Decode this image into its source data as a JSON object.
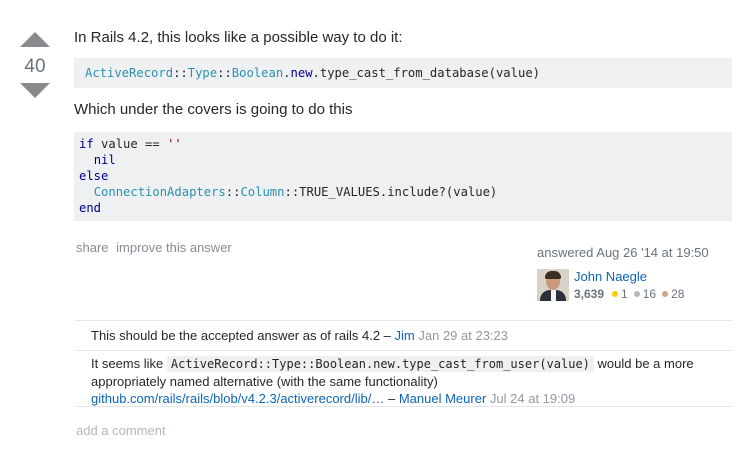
{
  "vote": {
    "score": "40"
  },
  "answer": {
    "intro": "In Rails 4.2, this looks like a possible way to do it:",
    "inline_code": {
      "t1": "ActiveRecord",
      "s1": "::",
      "t2": "Type",
      "s2": "::",
      "t3": "Boolean",
      "s3": ".",
      "k1": "new",
      "rest": ".type_cast_from_database(value)"
    },
    "middle": "Which under the covers is going to do this",
    "block": {
      "l1_kw": "if",
      "l1_mid": " value == ",
      "l1_str": "''",
      "l2_kw": "nil",
      "l3_kw": "else",
      "l4_t1": "ConnectionAdapters",
      "l4_s1": "::",
      "l4_t2": "Column",
      "l4_rest": "::TRUE_VALUES.include?(value)",
      "l5_kw": "end"
    }
  },
  "menu": {
    "share": "share",
    "improve": "improve this answer"
  },
  "signature": {
    "action": "answered",
    "time": "Aug 26 '14 at 19:50",
    "user_name": "John Naegle",
    "reputation": "3,639",
    "gold": "1",
    "silver": "16",
    "bronze": "28",
    "colors": {
      "gold": "#ffcc01",
      "silver": "#b4b8bc",
      "bronze": "#d1a684"
    }
  },
  "comments": [
    {
      "text": "This should be the accepted answer as of rails 4.2 –",
      "user": "Jim",
      "date": "Jan 29 at 23:23"
    },
    {
      "text_before": "It seems like",
      "code": "ActiveRecord::Type::Boolean.new.type_cast_from_user(value)",
      "text_after": "would be a more appropriately named alternative (with the same functionality)",
      "link": "github.com/rails/rails/blob/v4.2.3/activerecord/lib/…",
      "dash": "–",
      "user": "Manuel Meurer",
      "date": "Jul 24 at 19:09"
    }
  ],
  "add_comment": "add a comment"
}
